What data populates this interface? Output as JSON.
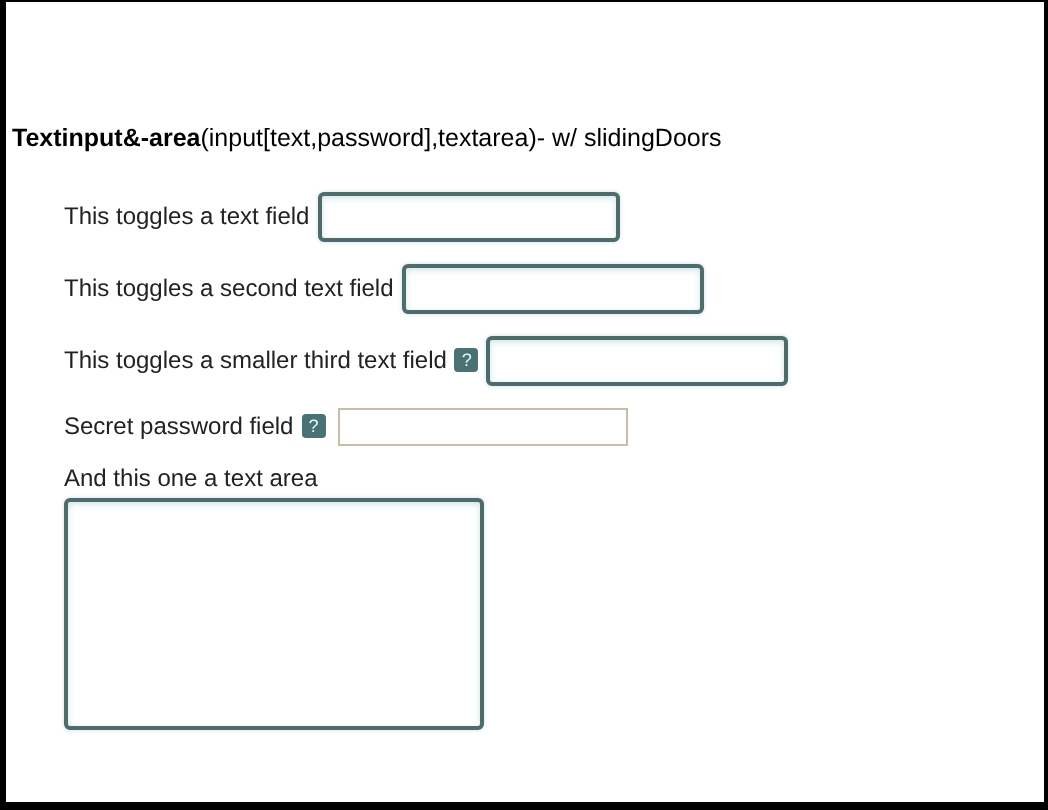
{
  "heading": "**Textinput&-area**(input[text,password],textarea)- w/ slidingDoors",
  "fields": [
    {
      "kind": "text",
      "label": "This toggles a text field"
    },
    {
      "kind": "text",
      "label": "This toggles a second text field"
    },
    {
      "kind": "text",
      "label": "This toggles a smaller third text field",
      "help": "?"
    },
    {
      "kind": "password",
      "label": "Secret password field",
      "help": "?"
    },
    {
      "kind": "textarea",
      "label": "And this one a text area"
    }
  ]
}
